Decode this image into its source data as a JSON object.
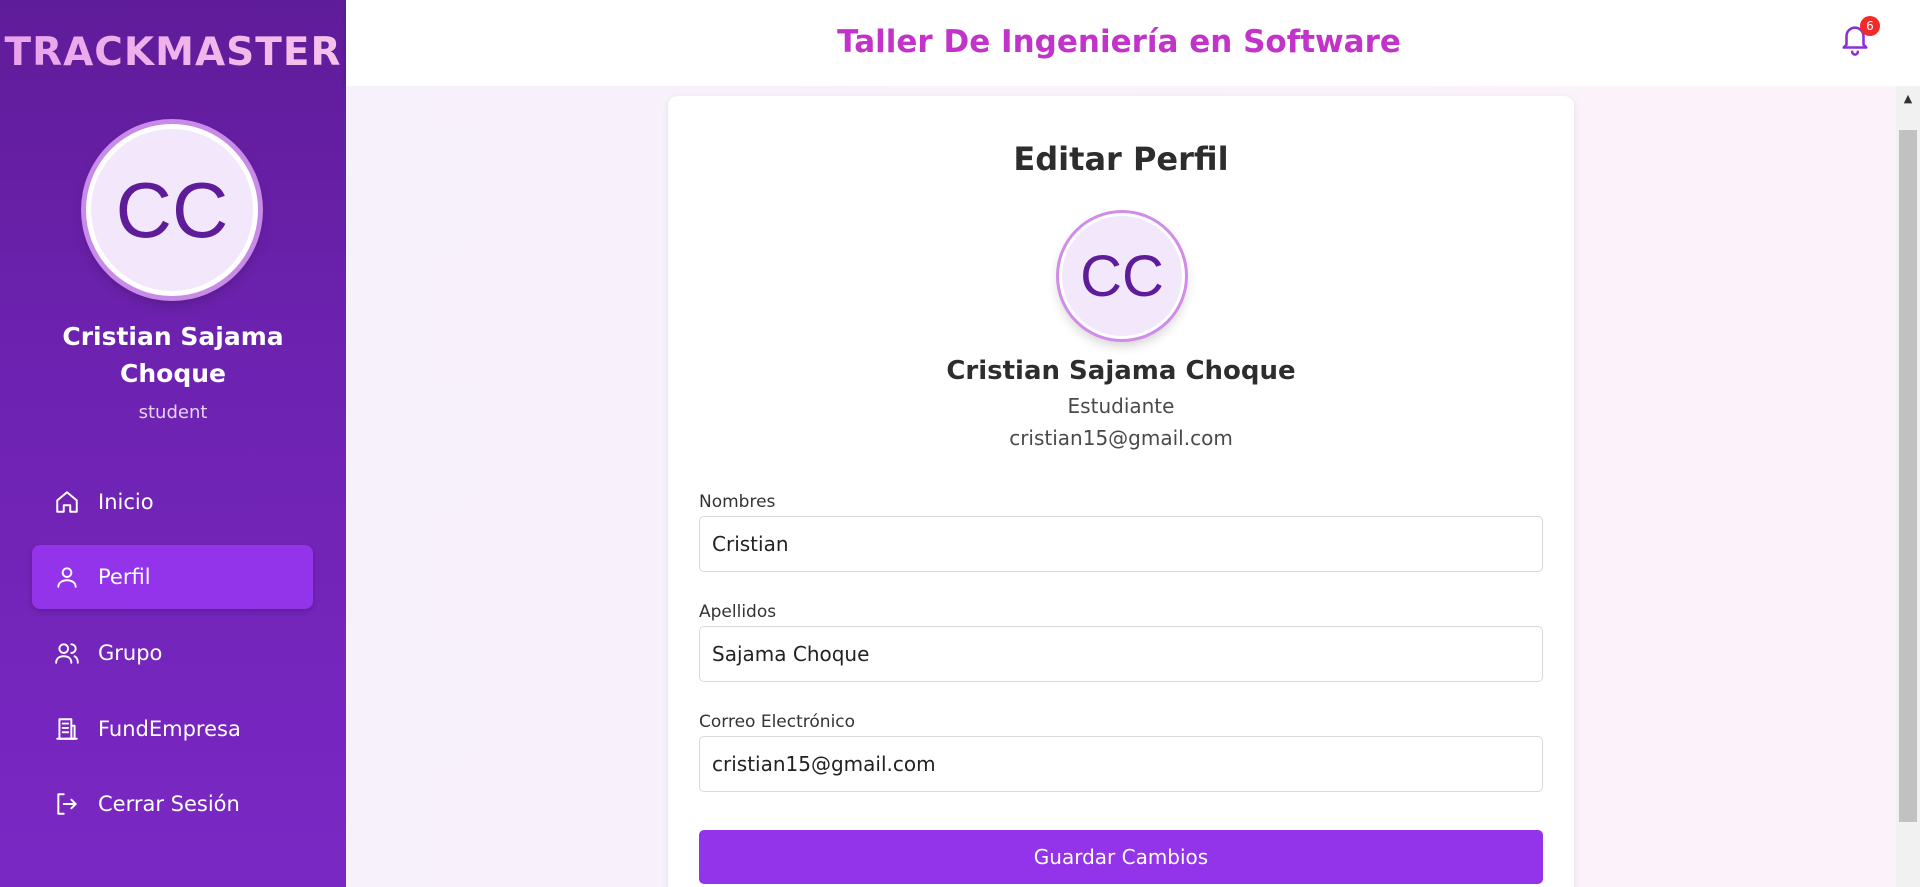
{
  "sidebar": {
    "brand": "TRACKMASTER",
    "avatar_initials": "CC",
    "user_name": "Cristian Sajama Choque",
    "user_role": "student",
    "items": [
      {
        "label": "Inicio",
        "icon": "home-icon"
      },
      {
        "label": "Perfil",
        "icon": "user-icon",
        "active": true
      },
      {
        "label": "Grupo",
        "icon": "users-icon"
      },
      {
        "label": "FundEmpresa",
        "icon": "building-icon"
      },
      {
        "label": "Cerrar Sesión",
        "icon": "logout-icon"
      }
    ]
  },
  "header": {
    "title": "Taller De Ingeniería en Software",
    "notification_count": "6"
  },
  "profile": {
    "title": "Editar Perfil",
    "avatar_initials": "CC",
    "name": "Cristian Sajama Choque",
    "role": "Estudiante",
    "email": "cristian15@gmail.com"
  },
  "form": {
    "nombres_label": "Nombres",
    "nombres_value": "Cristian",
    "apellidos_label": "Apellidos",
    "apellidos_value": "Sajama Choque",
    "correo_label": "Correo Electrónico",
    "correo_value": "cristian15@gmail.com",
    "save_label": "Guardar Cambios"
  },
  "colors": {
    "sidebar": "#6d22b0",
    "accent": "#9333ea",
    "header_title": "#c233c9",
    "badge": "#ef2b2b"
  }
}
